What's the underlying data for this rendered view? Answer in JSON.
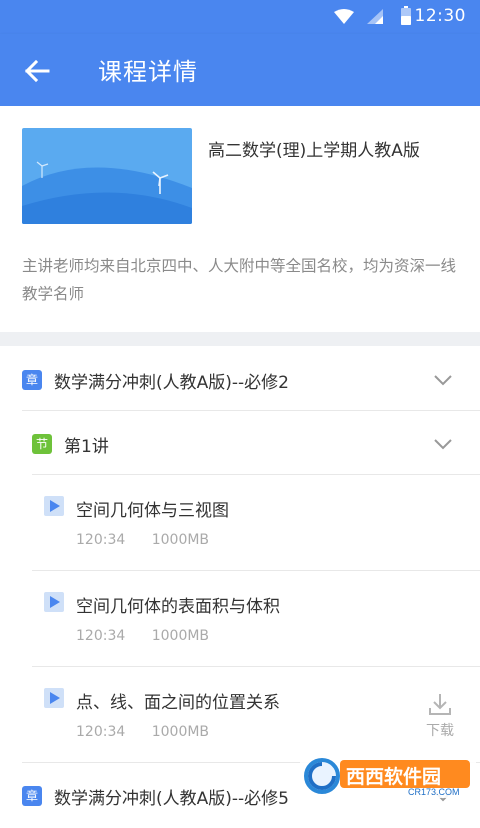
{
  "status": {
    "time": "12:30"
  },
  "header": {
    "title": "课程详情"
  },
  "course": {
    "title": "高二数学(理)上学期人教A版",
    "description": "主讲老师均来自北京四中、人大附中等全国名校，均为资深一线教学名师"
  },
  "chapters": [
    {
      "badge": "章",
      "label": "数学满分冲刺(人教A版)--必修2"
    },
    {
      "badge": "章",
      "label": "数学满分冲刺(人教A版)--必修5"
    }
  ],
  "section": {
    "badge": "节",
    "label": "第1讲"
  },
  "lessons": [
    {
      "title": "空间几何体与三视图",
      "duration": "120:34",
      "size": "1000MB"
    },
    {
      "title": "空间几何体的表面积与体积",
      "duration": "120:34",
      "size": "1000MB"
    },
    {
      "title": "点、线、面之间的位置关系",
      "duration": "120:34",
      "size": "1000MB"
    }
  ],
  "download": {
    "label": "下载"
  },
  "watermark": {
    "text": "西西软件园",
    "url": "CR173.COM"
  }
}
